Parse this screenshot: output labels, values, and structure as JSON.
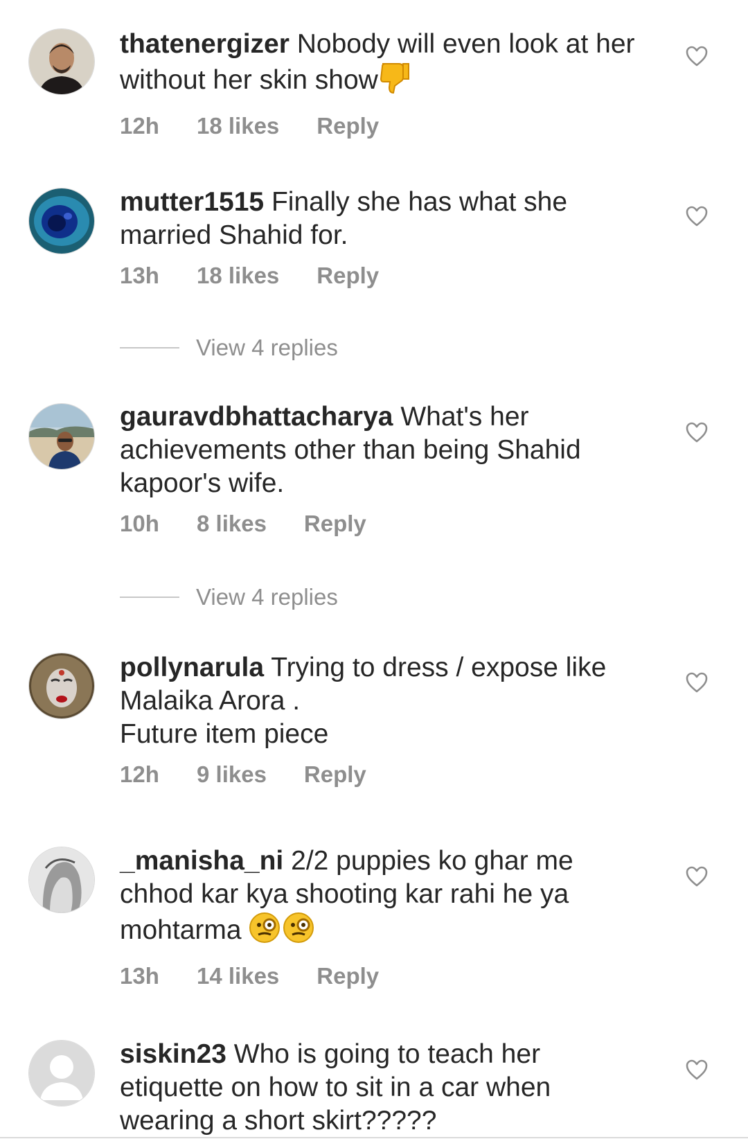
{
  "comments": [
    {
      "username": "thatenergizer",
      "text": "Nobody will even look at her\nwithout her skin show",
      "emoji": "thumbs-down",
      "time": "12h",
      "likes": "18 likes",
      "reply": "Reply"
    },
    {
      "username": "mutter1515",
      "text": "Finally she has what she\nmarried Shahid for.",
      "time": "13h",
      "likes": "18 likes",
      "reply": "Reply",
      "view_replies": "View 4 replies"
    },
    {
      "username": "gauravdbhattacharya",
      "text": "What's her\nachievements other than being Shahid\nkapoor's wife.",
      "time": "10h",
      "likes": "8 likes",
      "reply": "Reply",
      "view_replies": "View 4 replies"
    },
    {
      "username": "pollynarula",
      "text": "Trying to dress / expose  like\nMalaika Arora .\nFuture item piece",
      "time": "12h",
      "likes": "9 likes",
      "reply": "Reply"
    },
    {
      "username": "_manisha_ni",
      "text": "2/2 puppies ko ghar me\nchhod kar kya shooting kar rahi he ya\nmohtarma",
      "emoji": "face-with-monocle x2",
      "time": "13h",
      "likes": "14 likes",
      "reply": "Reply"
    },
    {
      "username": "siskin23",
      "text": "Who is going to teach her\netiquette on how to sit in a car when\nwearing a short skirt?????"
    }
  ],
  "icons": {
    "heart": "heart-outline-icon",
    "avatar_default": "default-avatar-icon"
  },
  "colors": {
    "text": "#262626",
    "meta": "#8e8e8e",
    "divider": "#c7c7c7"
  }
}
